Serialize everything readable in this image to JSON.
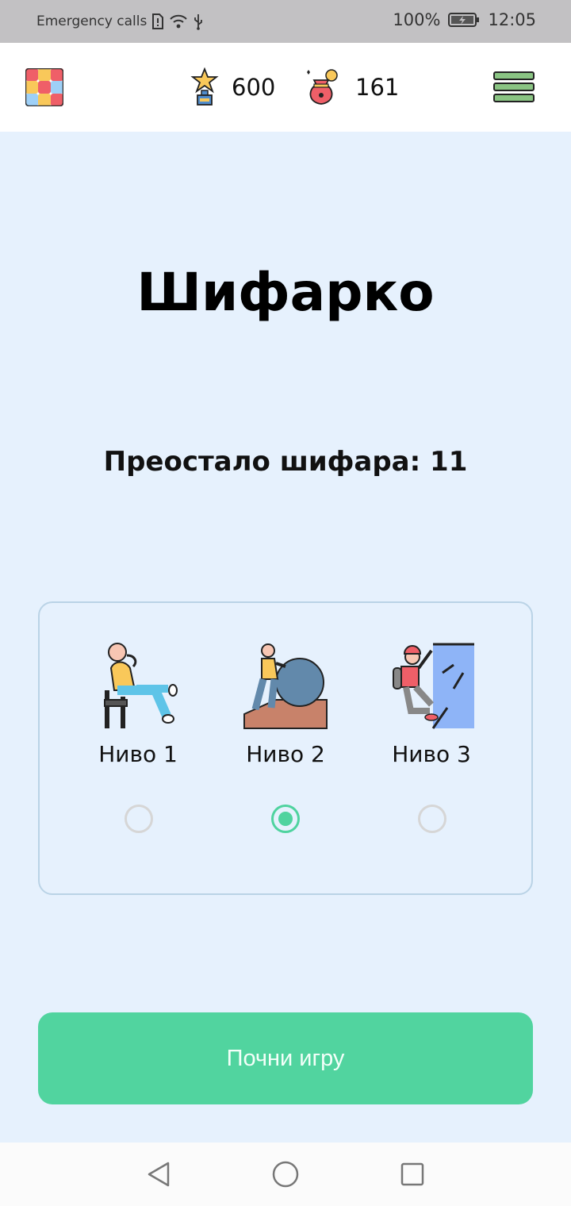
{
  "status_bar": {
    "left_text": "Emergency calls",
    "battery": "100%",
    "time": "12:05"
  },
  "header": {
    "trophy_count": "600",
    "coins_count": "161",
    "icons": [
      "grid-logo-icon",
      "trophy-icon",
      "money-bag-icon",
      "menu-icon"
    ]
  },
  "main": {
    "title": "Шифарко",
    "remaining_label": "Преостало шифара: 11"
  },
  "levels": {
    "items": [
      {
        "label": "Ниво 1",
        "icon": "relaxing-person-icon",
        "selected": false
      },
      {
        "label": "Ниво 2",
        "icon": "pushing-boulder-icon",
        "selected": true
      },
      {
        "label": "Ниво 3",
        "icon": "climber-icon",
        "selected": false
      }
    ]
  },
  "start_button": {
    "label": "Почни игру"
  },
  "colors": {
    "background": "#e6f1fd",
    "accent": "#51d49f",
    "card_border": "#bad3e6"
  },
  "nav": {
    "icons": [
      "back-icon",
      "home-icon",
      "recent-apps-icon"
    ]
  }
}
